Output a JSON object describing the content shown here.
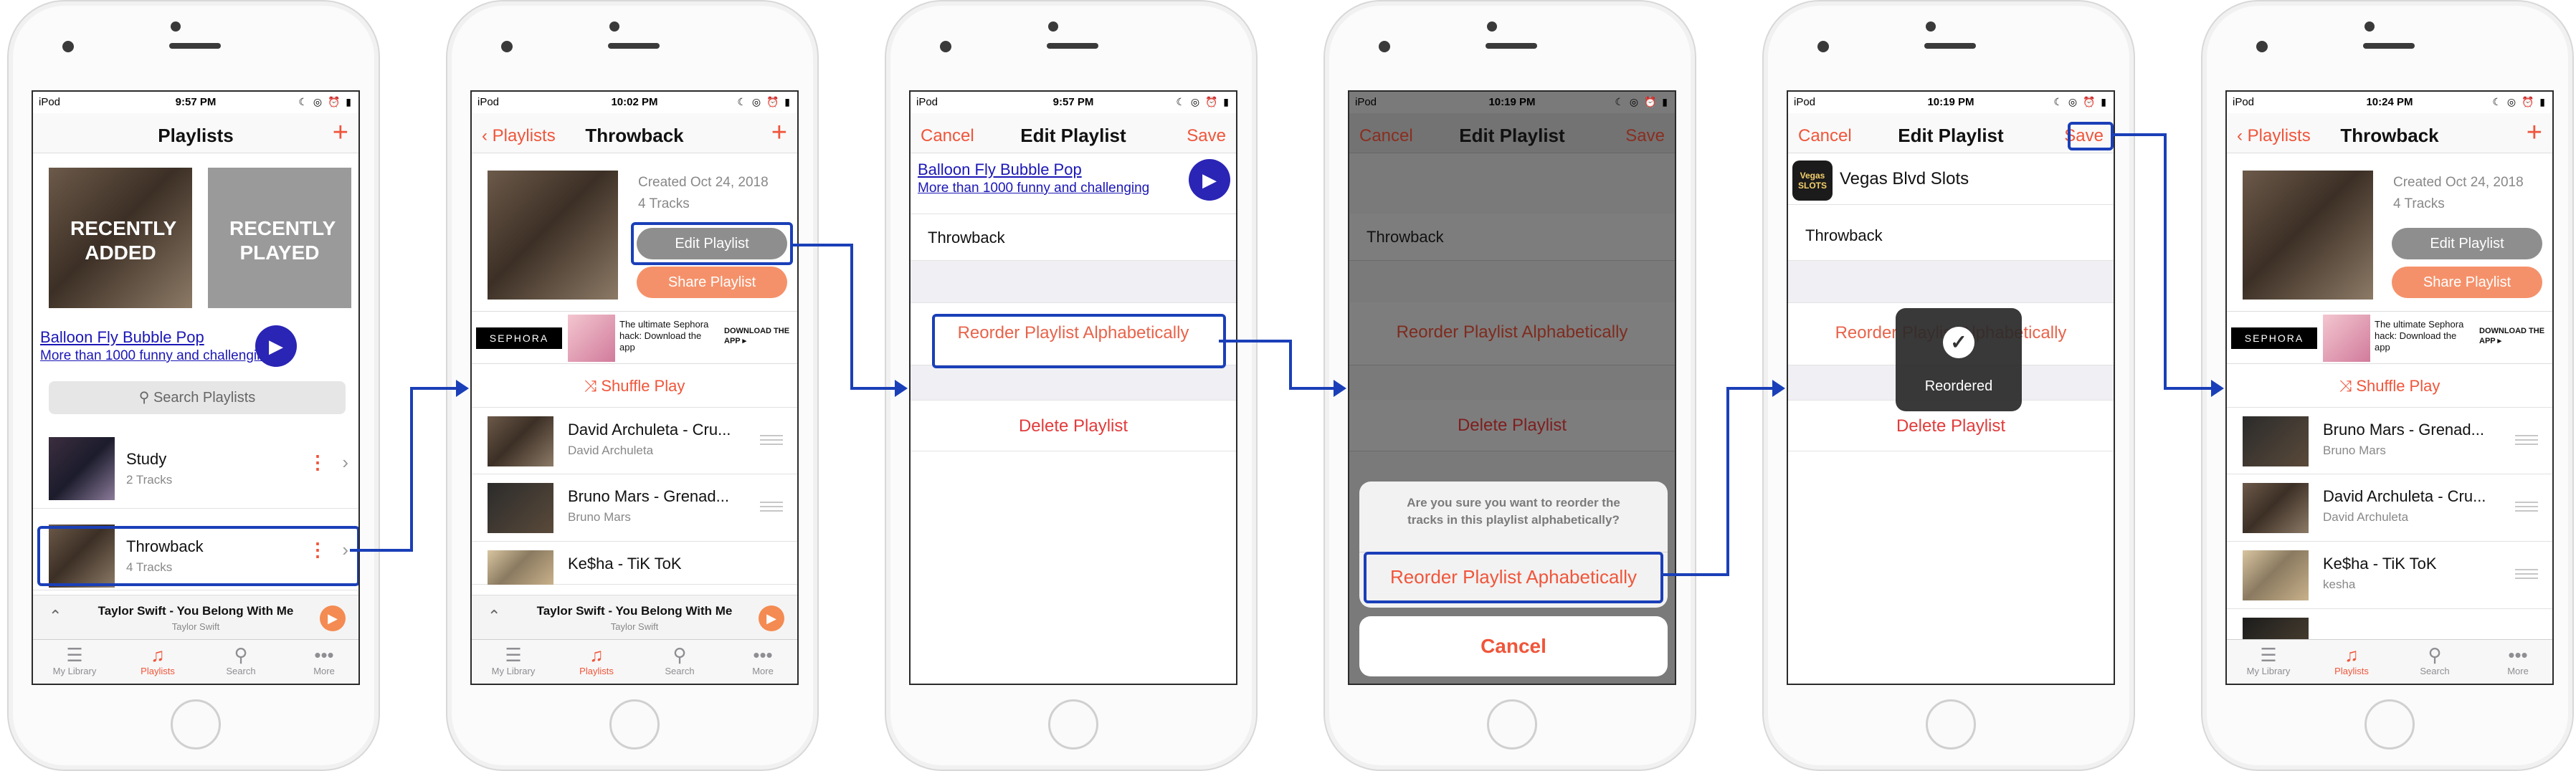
{
  "common": {
    "carrier": "iPod",
    "status_icons": "☾ ◎ ⏰ ▮",
    "tabs": [
      "My Library",
      "Playlists",
      "Search",
      "More"
    ],
    "mini_player": {
      "title": "Taylor Swift - You Belong With Me",
      "artist": "Taylor Swift"
    },
    "ad": {
      "title": "Balloon Fly Bubble Pop",
      "subtitle": "More than 1000 funny and challenging"
    },
    "accent_color": "#f0553a",
    "highlight_color": "#1a3fb8"
  },
  "screen1": {
    "time": "9:57 PM",
    "title": "Playlists",
    "add_label": "+",
    "recently_added": "RECENTLY ADDED",
    "recently_played": "RECENTLY PLAYED",
    "search_placeholder": "Search Playlists",
    "playlists": [
      {
        "name": "Study",
        "count": "2 Tracks"
      },
      {
        "name": "Throwback",
        "count": "4 Tracks"
      }
    ]
  },
  "screen2": {
    "time": "10:02 PM",
    "back_label": "Playlists",
    "title": "Throwback",
    "created": "Created Oct 24, 2018",
    "tracks_count": "4 Tracks",
    "edit_label": "Edit Playlist",
    "share_label": "Share Playlist",
    "ad_brand": "SEPHORA",
    "ad_text": "The ultimate Sephora hack: Download the app",
    "ad_cta": "DOWNLOAD THE APP ▸",
    "shuffle_label": "Shuffle Play",
    "tracks": [
      {
        "title": "David Archuleta - Cru...",
        "artist": "David Archuleta"
      },
      {
        "title": "Bruno Mars - Grenad...",
        "artist": "Bruno Mars"
      },
      {
        "title": "Ke$ha - TiK ToK",
        "artist": ""
      }
    ]
  },
  "screen3": {
    "time": "9:57 PM",
    "cancel": "Cancel",
    "title": "Edit Playlist",
    "save": "Save",
    "playlist_name": "Throwback",
    "reorder": "Reorder Playlist Alphabetically",
    "delete": "Delete Playlist"
  },
  "screen4": {
    "time": "10:19 PM",
    "cancel": "Cancel",
    "title": "Edit Playlist",
    "save": "Save",
    "playlist_name": "Throwback",
    "reorder": "Reorder Playlist Alphabetically",
    "delete": "Delete Playlist",
    "sheet_message": "Are you sure you want to reorder the tracks in this playlist alphabetically?",
    "sheet_action": "Reorder Playlist Aphabetically",
    "sheet_cancel": "Cancel"
  },
  "screen5": {
    "time": "10:19 PM",
    "cancel": "Cancel",
    "title": "Edit Playlist",
    "save": "Save",
    "ad_logo": "Vegas SLOTS",
    "ad_title": "Vegas Blvd Slots",
    "playlist_name": "Throwback",
    "reorder": "Reorder Playlist Alphabetically",
    "delete": "Delete Playlist",
    "toast": "Reordered"
  },
  "screen6": {
    "time": "10:24 PM",
    "back_label": "Playlists",
    "title": "Throwback",
    "created": "Created Oct 24, 2018",
    "tracks_count": "4 Tracks",
    "edit_label": "Edit Playlist",
    "share_label": "Share Playlist",
    "ad_brand": "SEPHORA",
    "ad_text": "The ultimate Sephora hack: Download the app",
    "ad_cta": "DOWNLOAD THE APP ▸",
    "shuffle_label": "Shuffle Play",
    "tracks": [
      {
        "title": "Bruno Mars - Grenad...",
        "artist": "Bruno Mars"
      },
      {
        "title": "David Archuleta - Cru...",
        "artist": "David Archuleta"
      },
      {
        "title": "Ke$ha - TiK ToK",
        "artist": "kesha"
      }
    ]
  }
}
